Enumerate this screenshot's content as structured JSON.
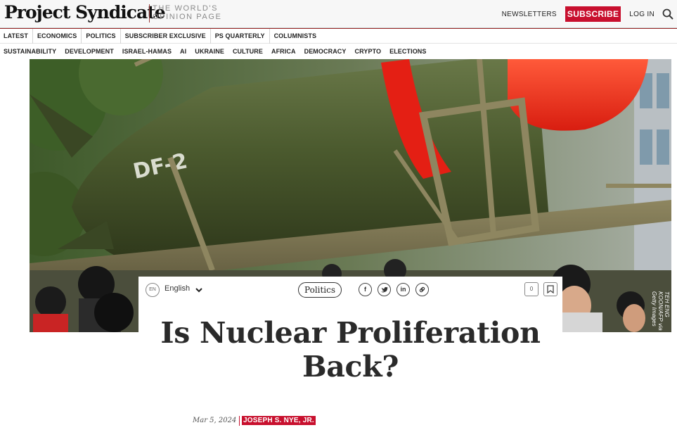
{
  "header": {
    "logo": "Project Syndicate",
    "tagline_line1": "THE WORLD'S",
    "tagline_line2": "OPINION PAGE",
    "newsletters": "NEWSLETTERS",
    "subscribe": "SUBSCRIBE",
    "login": "LOG IN",
    "search_icon": "search-icon"
  },
  "nav_primary": [
    "LATEST",
    "ECONOMICS",
    "POLITICS",
    "SUBSCRIBER EXCLUSIVE",
    "PS QUARTERLY",
    "COLUMNISTS"
  ],
  "nav_secondary": [
    "SUSTAINABILITY",
    "DEVELOPMENT",
    "ISRAEL-HAMAS",
    "AI",
    "UKRAINE",
    "CULTURE",
    "AFRICA",
    "DEMOCRACY",
    "CRYPTO",
    "ELECTIONS"
  ],
  "hero": {
    "missile_marking": "DF-2",
    "credit": "TEH ENG KOON/AFP via Getty Images"
  },
  "toolbar": {
    "lang_badge": "EN",
    "lang_label": "English",
    "category": "Politics",
    "share_icons": [
      "facebook-icon",
      "twitter-icon",
      "linkedin-icon",
      "link-icon"
    ],
    "comments_count": "0",
    "bookmark_icon": "bookmark-icon"
  },
  "article": {
    "title_line1": "Is Nuclear Proliferation",
    "title_line2": "Back?",
    "date": "Mar 5, 2024",
    "author": "JOSEPH S. NYE, JR."
  },
  "colors": {
    "brand_red": "#c8102e",
    "nav_text": "#222222",
    "headline": "#2a2a2a"
  }
}
